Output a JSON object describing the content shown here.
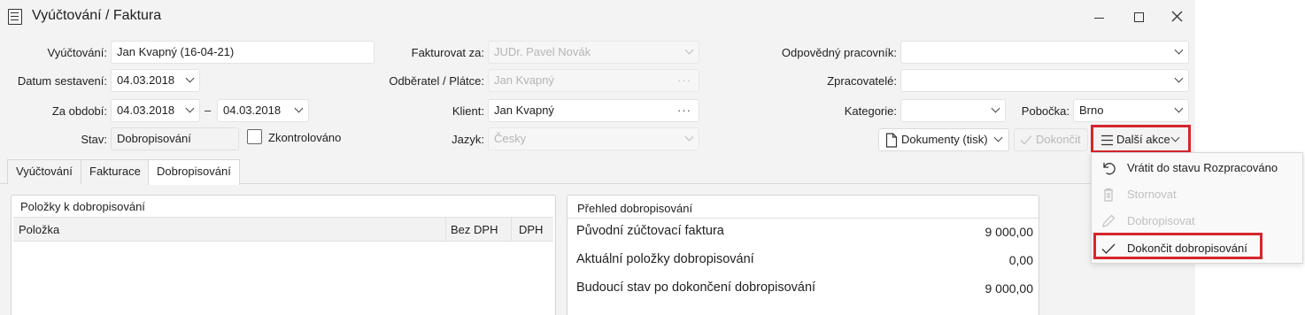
{
  "window": {
    "title": "Vyúčtování / Faktura",
    "controls": {
      "minimize": "–",
      "maximize": "□",
      "close": "✕"
    }
  },
  "form": {
    "vyuctovani": {
      "label": "Vyúčtování:",
      "value": "Jan Kvapný (16-04-21)"
    },
    "datum_sestaveni": {
      "label": "Datum sestavení:",
      "value": "04.03.2018"
    },
    "za_obdobi": {
      "label": "Za období:",
      "from": "04.03.2018",
      "separator": "–",
      "to": "04.03.2018"
    },
    "stav": {
      "label": "Stav:",
      "value": "Dobropisování"
    },
    "zkontrolovano": {
      "label": "Zkontrolováno",
      "checked": false
    },
    "fakturovat_za": {
      "label": "Fakturovat za:",
      "value": "JUDr. Pavel Novák"
    },
    "odberatel": {
      "label": "Odběratel / Plátce:",
      "value": "Jan Kvapný"
    },
    "klient": {
      "label": "Klient:",
      "value": "Jan Kvapný"
    },
    "jazyk": {
      "label": "Jazyk:",
      "value": "Česky"
    },
    "odpovedny_pracovnik": {
      "label": "Odpovědný pracovník:",
      "value": ""
    },
    "zpracovatele": {
      "label": "Zpracovatelé:",
      "value": ""
    },
    "kategorie": {
      "label": "Kategorie:",
      "value": ""
    },
    "pobocka": {
      "label": "Pobočka:",
      "value": "Brno"
    }
  },
  "actions": {
    "dokumenty": "Dokumenty (tisk)",
    "dokoncit": "Dokončit",
    "dalsi_akce": "Další akce"
  },
  "tabs": [
    {
      "label": "Vyúčtování",
      "active": false
    },
    {
      "label": "Fakturace",
      "active": false
    },
    {
      "label": "Dobropisování",
      "active": true
    }
  ],
  "polozky_panel": {
    "title": "Položky k dobropisování",
    "columns": [
      "Položka",
      "Bez DPH",
      "DPH"
    ]
  },
  "prehled_panel": {
    "title": "Přehled dobropisování",
    "rows": [
      {
        "label": "Původní zúčtovací faktura",
        "value": "9 000,00"
      },
      {
        "label": "Aktuální položky dobropisování",
        "value": "0,00"
      },
      {
        "label": "Budoucí stav po dokončení dobropisování",
        "value": "9 000,00"
      }
    ]
  },
  "menu": {
    "items": [
      {
        "label": "Vrátit do stavu Rozpracováno",
        "icon": "undo-icon",
        "enabled": true
      },
      {
        "label": "Stornovat",
        "icon": "trash-icon",
        "enabled": false
      },
      {
        "label": "Dobropisovat",
        "icon": "pencil-icon",
        "enabled": false
      },
      {
        "label": "Dokončit dobropisování",
        "icon": "check-icon",
        "enabled": true,
        "highlighted": true
      }
    ]
  },
  "colors": {
    "highlight": "#d6252c",
    "window_bg": "#f3f3f3",
    "disabled_text": "#b5b5b5"
  }
}
